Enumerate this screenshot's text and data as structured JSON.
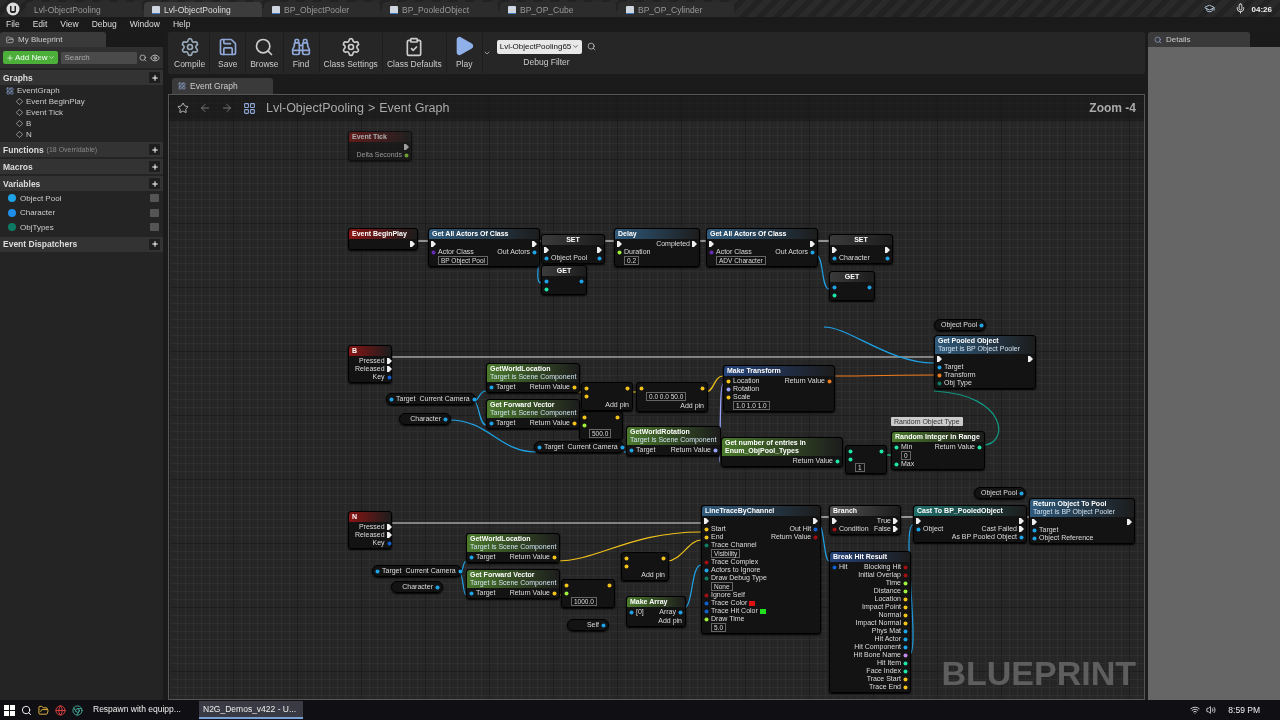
{
  "title_tabs": [
    {
      "label": "Lvl-ObjectPooling",
      "selected": false
    },
    {
      "label": "Lvl-ObjectPooling",
      "selected": true
    },
    {
      "label": "BP_ObjectPooler",
      "selected": false
    },
    {
      "label": "BP_PooledObject",
      "selected": false
    },
    {
      "label": "BP_OP_Cube",
      "selected": false
    },
    {
      "label": "BP_OP_Cylinder",
      "selected": false
    }
  ],
  "recorder_time": "04:26",
  "menu": [
    "File",
    "Edit",
    "View",
    "Debug",
    "Window",
    "Help"
  ],
  "my_blueprint": {
    "tab": "My Blueprint",
    "add_button": "Add New",
    "search_placeholder": "Search",
    "sections": [
      {
        "title": "Graphs",
        "items": [
          {
            "label": "EventGraph",
            "children": [
              {
                "label": "Event BeginPlay"
              },
              {
                "label": "Event Tick"
              },
              {
                "label": "B"
              },
              {
                "label": "N"
              }
            ]
          }
        ]
      },
      {
        "title": "Functions",
        "note": "(18 Overridable)"
      },
      {
        "title": "Macros"
      },
      {
        "title": "Variables",
        "items": [
          {
            "label": "Object Pool",
            "color": "#1ea3e8"
          },
          {
            "label": "Character",
            "color": "#1e8ee8"
          },
          {
            "label": "ObjTypes",
            "color": "#0f7a63"
          }
        ]
      },
      {
        "title": "Event Dispatchers"
      }
    ]
  },
  "toolbar": {
    "buttons": [
      "Compile",
      "Save",
      "Browse",
      "Find",
      "Class Settings",
      "Class Defaults",
      "Play"
    ],
    "debug_filter": {
      "value": "Lvl-ObjectPooling65",
      "label": "Debug Filter"
    }
  },
  "graph_tab": "Event Graph",
  "breadcrumb": {
    "items": [
      "Lvl-ObjectPooling",
      "Event Graph"
    ],
    "separator": ">"
  },
  "zoom": "Zoom -4",
  "overlay_label": "BLUEPRINT",
  "tooltip": "Random Object Type",
  "nodes": [
    {
      "kind": "event",
      "title": "Event Tick",
      "disabled": true,
      "outputs": [
        {
          "kind": "exec"
        },
        {
          "label": "Delta Seconds",
          "kind": "float"
        }
      ]
    },
    {
      "kind": "event",
      "title": "Event BeginPlay",
      "disabled": false,
      "outputs": [
        {
          "kind": "exec"
        }
      ]
    },
    {
      "kind": "function",
      "title": "Get All Actors Of Class",
      "disabled": false,
      "inputs": [
        {
          "kind": "exec"
        },
        {
          "label": "Actor Class",
          "kind": "class",
          "value": "BP Object Pool"
        }
      ],
      "outputs": [
        {
          "kind": "exec"
        },
        {
          "label": "Out Actors",
          "kind": "object"
        }
      ]
    },
    {
      "kind": "set",
      "title": "SET",
      "disabled": false,
      "inputs": [
        {
          "kind": "exec"
        },
        {
          "label": "Object Pool",
          "kind": "object"
        }
      ],
      "outputs": [
        {
          "kind": "exec"
        },
        {
          "kind": "object"
        }
      ]
    },
    {
      "kind": "get",
      "title": "GET",
      "disabled": false,
      "inputs": [
        {
          "kind": "object"
        },
        {
          "kind": "int"
        }
      ],
      "outputs": [
        {
          "kind": "object"
        }
      ]
    },
    {
      "kind": "function",
      "title": "Delay",
      "disabled": false,
      "inputs": [
        {
          "kind": "exec"
        },
        {
          "label": "Duration",
          "kind": "float",
          "value": "0.2"
        }
      ],
      "outputs": [
        {
          "label": "Completed",
          "kind": "exec"
        }
      ]
    },
    {
      "kind": "function",
      "title": "Get All Actors Of Class",
      "disabled": false,
      "inputs": [
        {
          "kind": "exec"
        },
        {
          "label": "Actor Class",
          "kind": "class",
          "value": "ADV Character"
        }
      ],
      "outputs": [
        {
          "kind": "exec"
        },
        {
          "label": "Out Actors",
          "kind": "object"
        }
      ]
    },
    {
      "kind": "set",
      "title": "SET",
      "disabled": false,
      "inputs": [
        {
          "kind": "exec"
        },
        {
          "label": "Character",
          "kind": "object"
        }
      ],
      "outputs": [
        {
          "kind": "exec"
        },
        {
          "kind": "object"
        }
      ]
    },
    {
      "kind": "get",
      "title": "GET",
      "disabled": false,
      "inputs": [
        {
          "kind": "object"
        },
        {
          "kind": "int"
        }
      ],
      "outputs": [
        {
          "kind": "object"
        }
      ]
    },
    {
      "kind": "event",
      "title": "B",
      "disabled": false,
      "outputs": [
        {
          "label": "Pressed",
          "kind": "exec"
        },
        {
          "label": "Released",
          "kind": "exec"
        },
        {
          "label": "Key",
          "kind": "struct"
        }
      ]
    },
    {
      "kind": "variable",
      "disabled": false,
      "inputs": [
        {
          "label": "Target",
          "kind": "object"
        }
      ],
      "outputs": [
        {
          "label": "Current Camera",
          "kind": "object"
        }
      ]
    },
    {
      "kind": "variable",
      "disabled": false,
      "outputs": [
        {
          "label": "Character",
          "kind": "object"
        }
      ]
    },
    {
      "kind": "pure",
      "title": "GetWorldLocation",
      "subtitle": "Target is Scene Component",
      "disabled": false,
      "inputs": [
        {
          "label": "Target",
          "kind": "object"
        }
      ],
      "outputs": [
        {
          "label": "Return Value",
          "kind": "vector"
        }
      ]
    },
    {
      "kind": "pure",
      "title": "Get Forward Vector",
      "subtitle": "Target is Scene Component",
      "disabled": false,
      "inputs": [
        {
          "label": "Target",
          "kind": "object"
        }
      ],
      "outputs": [
        {
          "label": "Return Value",
          "kind": "vector"
        }
      ]
    },
    {
      "kind": "struct",
      "title": "Make Transform",
      "disabled": false,
      "inputs": [
        {
          "label": "Location",
          "kind": "vector"
        },
        {
          "label": "Rotation",
          "kind": "rotator"
        },
        {
          "label": "Scale",
          "kind": "vector",
          "value": "1.0 1.0 1.0"
        }
      ],
      "outputs": [
        {
          "label": "Return Value",
          "kind": "transform"
        }
      ]
    },
    {
      "kind": "variable",
      "disabled": false,
      "outputs": [
        {
          "label": "Object Pool",
          "kind": "object"
        }
      ]
    },
    {
      "kind": "function",
      "title": "Get Pooled Object",
      "subtitle": "Target is BP Object Pooler",
      "disabled": false,
      "inputs": [
        {
          "kind": "exec"
        },
        {
          "label": "Target",
          "kind": "object"
        },
        {
          "label": "Transform",
          "kind": "transform"
        },
        {
          "label": "Obj Type",
          "kind": "byte"
        }
      ],
      "outputs": [
        {
          "kind": "exec"
        }
      ]
    },
    {
      "kind": "variable",
      "disabled": false,
      "inputs": [
        {
          "label": "Target",
          "kind": "object"
        }
      ],
      "outputs": [
        {
          "label": "Current Camera",
          "kind": "object"
        }
      ]
    },
    {
      "kind": "pure",
      "title": "GetWorldRotation",
      "subtitle": "Target is Scene Component",
      "disabled": false,
      "inputs": [
        {
          "label": "Target",
          "kind": "object"
        }
      ],
      "outputs": [
        {
          "label": "Return Value",
          "kind": "rotator"
        }
      ]
    },
    {
      "kind": "pure",
      "title": "Get number of entries in Enum_ObjPool_Types",
      "disabled": false,
      "outputs": [
        {
          "label": "Return Value",
          "kind": "int"
        }
      ]
    },
    {
      "kind": "pure",
      "title": "Random Integer in Range",
      "disabled": false,
      "inputs": [
        {
          "label": "Min",
          "kind": "int",
          "value": "0"
        },
        {
          "label": "Max",
          "kind": "int"
        }
      ],
      "outputs": [
        {
          "label": "Return Value",
          "kind": "int"
        }
      ]
    },
    {
      "kind": "event",
      "title": "N",
      "disabled": false,
      "outputs": [
        {
          "label": "Pressed",
          "kind": "exec"
        },
        {
          "label": "Released",
          "kind": "exec"
        },
        {
          "label": "Key",
          "kind": "struct"
        }
      ]
    },
    {
      "kind": "pure",
      "title": "GetWorldLocation",
      "subtitle": "Target is Scene Component",
      "disabled": false,
      "inputs": [
        {
          "label": "Target",
          "kind": "object"
        }
      ],
      "outputs": [
        {
          "label": "Return Value",
          "kind": "vector"
        }
      ]
    },
    {
      "kind": "pure",
      "title": "Get Forward Vector",
      "subtitle": "Target is Scene Component",
      "disabled": false,
      "inputs": [
        {
          "label": "Target",
          "kind": "object"
        }
      ],
      "outputs": [
        {
          "label": "Return Value",
          "kind": "vector"
        }
      ]
    },
    {
      "kind": "variable",
      "disabled": false,
      "inputs": [
        {
          "label": "Target",
          "kind": "object"
        }
      ],
      "outputs": [
        {
          "label": "Current Camera",
          "kind": "object"
        }
      ]
    },
    {
      "kind": "variable",
      "disabled": false,
      "outputs": [
        {
          "label": "Character",
          "kind": "object"
        }
      ]
    },
    {
      "kind": "variable",
      "disabled": false,
      "outputs": [
        {
          "label": "Self",
          "kind": "object"
        }
      ]
    },
    {
      "kind": "pure",
      "title": "Make Array",
      "disabled": false,
      "inputs": [
        {
          "label": "[0]",
          "kind": "object"
        }
      ],
      "outputs": [
        {
          "label": "Array",
          "kind": "object"
        }
      ],
      "footer": "Add pin"
    },
    {
      "kind": "function",
      "title": "LineTraceByChannel",
      "disabled": false,
      "inputs": [
        {
          "kind": "exec"
        },
        {
          "label": "Start",
          "kind": "vector"
        },
        {
          "label": "End",
          "kind": "vector"
        },
        {
          "label": "Trace Channel",
          "kind": "byte",
          "value": "Visibility"
        },
        {
          "label": "Trace Complex",
          "kind": "bool"
        },
        {
          "label": "Actors to Ignore",
          "kind": "object"
        },
        {
          "label": "Draw Debug Type",
          "kind": "byte",
          "value": "None"
        },
        {
          "label": "Ignore Self",
          "kind": "bool"
        },
        {
          "label": "Trace Color",
          "kind": "color",
          "color": "#e01010"
        },
        {
          "label": "Trace Hit Color",
          "kind": "color",
          "color": "#20e020"
        },
        {
          "label": "Draw Time",
          "kind": "float",
          "value": "5.0"
        }
      ],
      "outputs": [
        {
          "kind": "exec"
        },
        {
          "label": "Out Hit",
          "kind": "struct"
        },
        {
          "label": "Return Value",
          "kind": "bool"
        }
      ]
    },
    {
      "kind": "macro",
      "title": "Branch",
      "disabled": false,
      "inputs": [
        {
          "kind": "exec"
        },
        {
          "label": "Condition",
          "kind": "bool"
        }
      ],
      "outputs": [
        {
          "label": "True",
          "kind": "exec"
        },
        {
          "label": "False",
          "kind": "exec"
        }
      ]
    },
    {
      "kind": "struct",
      "title": "Break Hit Result",
      "disabled": false,
      "inputs": [
        {
          "label": "Hit",
          "kind": "struct"
        }
      ],
      "outputs": [
        {
          "label": "Blocking Hit",
          "kind": "bool"
        },
        {
          "label": "Initial Overlap",
          "kind": "bool"
        },
        {
          "label": "Time",
          "kind": "float"
        },
        {
          "label": "Distance",
          "kind": "float"
        },
        {
          "label": "Location",
          "kind": "vector"
        },
        {
          "label": "Impact Point",
          "kind": "vector"
        },
        {
          "label": "Normal",
          "kind": "vector"
        },
        {
          "label": "Impact Normal",
          "kind": "vector"
        },
        {
          "label": "Phys Mat",
          "kind": "object"
        },
        {
          "label": "Hit Actor",
          "kind": "object"
        },
        {
          "label": "Hit Component",
          "kind": "object"
        },
        {
          "label": "Hit Bone Name",
          "kind": "name"
        },
        {
          "label": "Hit Item",
          "kind": "int"
        },
        {
          "label": "Face Index",
          "kind": "int"
        },
        {
          "label": "Trace Start",
          "kind": "vector"
        },
        {
          "label": "Trace End",
          "kind": "vector"
        }
      ]
    },
    {
      "kind": "variable",
      "disabled": false,
      "outputs": [
        {
          "label": "Object Pool",
          "kind": "object"
        }
      ]
    },
    {
      "kind": "cast",
      "title": "Cast To BP_PooledObject",
      "disabled": false,
      "inputs": [
        {
          "kind": "exec"
        },
        {
          "label": "Object",
          "kind": "object"
        }
      ],
      "outputs": [
        {
          "kind": "exec"
        },
        {
          "label": "Cast Failed",
          "kind": "exec"
        },
        {
          "label": "As BP Pooled Object",
          "kind": "object"
        }
      ]
    },
    {
      "kind": "function",
      "title": "Return Object To Pool",
      "subtitle": "Target is BP Object Pooler",
      "disabled": false,
      "inputs": [
        {
          "kind": "exec"
        },
        {
          "label": "Target",
          "kind": "object"
        },
        {
          "label": "Object Reference",
          "kind": "object"
        }
      ],
      "outputs": [
        {
          "kind": "exec"
        }
      ]
    },
    {
      "kind": "math",
      "disabled": false,
      "inputs": [
        {
          "kind": "vector"
        },
        {
          "kind": "vector"
        }
      ],
      "outputs": [
        {
          "kind": "vector"
        }
      ],
      "footer": "Add pin"
    },
    {
      "kind": "math",
      "disabled": false,
      "inputs": [
        {
          "kind": "vector",
          "value": "0.0 0.0 50.0"
        }
      ],
      "outputs": [
        {
          "kind": "vector"
        }
      ],
      "footer": "Add pin"
    },
    {
      "kind": "math",
      "disabled": false,
      "inputs": [
        {
          "kind": "vector"
        },
        {
          "kind": "float",
          "value": "500.0"
        }
      ],
      "outputs": [
        {
          "kind": "vector"
        }
      ]
    },
    {
      "kind": "math",
      "disabled": false,
      "inputs": [
        {
          "kind": "vector"
        },
        {
          "kind": "vector"
        }
      ],
      "outputs": [
        {
          "kind": "vector"
        }
      ],
      "footer": "Add pin"
    },
    {
      "kind": "math",
      "disabled": false,
      "inputs": [
        {
          "kind": "vector"
        },
        {
          "kind": "float",
          "value": "1000.0"
        }
      ],
      "outputs": [
        {
          "kind": "vector"
        }
      ]
    },
    {
      "kind": "math",
      "disabled": false,
      "inputs": [
        {
          "kind": "int"
        },
        {
          "kind": "int",
          "value": "1"
        }
      ],
      "outputs": [
        {
          "kind": "int"
        }
      ]
    }
  ],
  "details_tab": "Details",
  "taskbar": {
    "windows": [
      {
        "label": "Respawn with equipp...",
        "selected": false
      },
      {
        "label": "N2G_Demos_v422 - U...",
        "selected": true
      }
    ],
    "clock": "8:59 PM"
  }
}
